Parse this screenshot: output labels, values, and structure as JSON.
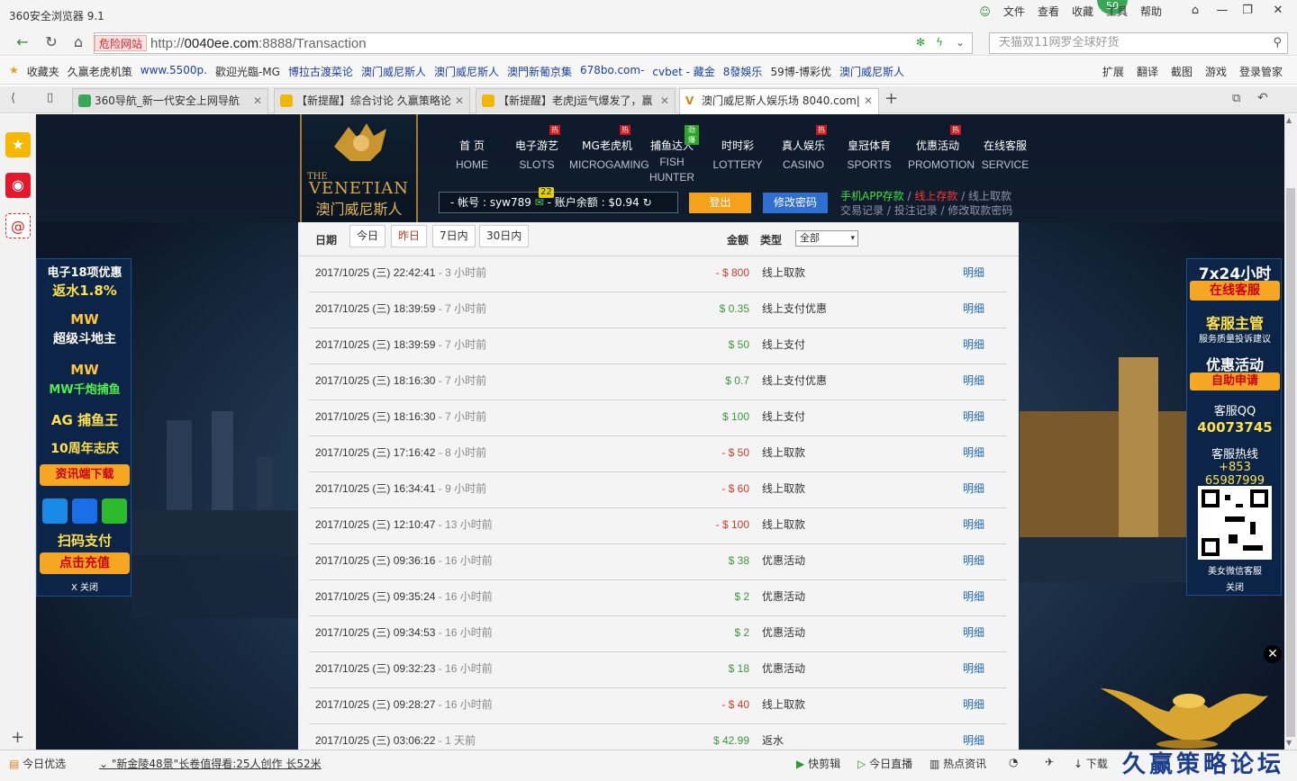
{
  "browser": {
    "title": "360安全浏览器 9.1",
    "menus": [
      "文件",
      "查看",
      "收藏",
      "工具",
      "帮助"
    ],
    "badge": "50",
    "danger_label": "危险网站",
    "url_prefix": "http://",
    "url_host": "0040ee.com",
    "url_rest": ":8888/Transaction",
    "search_placeholder": "天猫双11网罗全球好货"
  },
  "favorites": {
    "label": "收藏夹",
    "items": [
      "久赢老虎机策",
      "www.5500p.",
      "歡迎光臨-MG",
      "博拉古渡菜论",
      "澳门威尼斯人",
      "澳门威尼斯人",
      "澳門新葡京集",
      "678bo.com-",
      "cvbet - 藏金",
      "8發娛乐",
      "59博-博彩优",
      "澳门威尼斯人"
    ],
    "tools": [
      "扩展",
      "翻译",
      "截图",
      "游戏",
      "登录管家"
    ]
  },
  "tabs": [
    {
      "label": "360导航_新一代安全上网导航",
      "active": false
    },
    {
      "label": "【新提醒】综合讨论 久赢策略论",
      "active": false
    },
    {
      "label": "【新提醒】老虎J运气爆发了，赢",
      "active": false
    },
    {
      "label": "澳门威尼斯人娱乐场 8040.com|",
      "active": true
    }
  ],
  "site": {
    "logo_the": "THE",
    "logo_name": "VENETIAN",
    "logo_zh": "澳门威尼斯人",
    "nav": [
      {
        "zh": "首 页",
        "en": "HOME",
        "hot": ""
      },
      {
        "zh": "电子游艺",
        "en": "SLOTS",
        "hot": "热"
      },
      {
        "zh": "MG老虎机",
        "en": "MICROGAMING",
        "hot": "热"
      },
      {
        "zh": "捕鱼达人",
        "en": "FISH HUNTER",
        "hot": "劲爆"
      },
      {
        "zh": "时时彩",
        "en": "LOTTERY",
        "hot": ""
      },
      {
        "zh": "真人娱乐",
        "en": "CASINO",
        "hot": "热"
      },
      {
        "zh": "皇冠体育",
        "en": "SPORTS",
        "hot": ""
      },
      {
        "zh": "优惠活动",
        "en": "PROMOTION",
        "hot": "热"
      },
      {
        "zh": "在线客服",
        "en": "SERVICE",
        "hot": ""
      }
    ],
    "account_text": "- 帐号 : syw789",
    "msg_count": "22",
    "balance_text": "- 账户余额 : $0.94",
    "logout": "登出",
    "change_password": "修改密码",
    "links_row1": [
      "手机APP存款",
      "线上存款",
      "线上取款"
    ],
    "links_row2": [
      "交易记录",
      "投注记录",
      "修改取款密码"
    ]
  },
  "left_panel": [
    "电子18项优惠",
    "返水1.8%",
    "MW",
    "超级斗地主",
    "MW",
    "MW千炮捕鱼",
    "AG 捕鱼王",
    "10周年志庆",
    "资讯端下载",
    "扫码支付",
    "点击充值",
    "X 关闭"
  ],
  "right_panel": [
    "7x24小时",
    "在线客服",
    "客服主管",
    "服务质量投诉建议",
    "优惠活动",
    "自助申请",
    "客服QQ",
    "40073745",
    "客服热线",
    "+853 65987999",
    "美女微信客服",
    "关闭"
  ],
  "filter": {
    "date_label": "日期",
    "buttons": [
      "今日",
      "昨日",
      "7日内",
      "30日内"
    ],
    "amount_label": "金额",
    "type_label": "类型",
    "type_value": "全部"
  },
  "transactions": [
    {
      "date": "2017/10/25 (三) 22:42:41",
      "ago": " - 3 小时前",
      "amount": "- $ 800",
      "type": "线上取款",
      "detail": "明细"
    },
    {
      "date": "2017/10/25 (三) 18:39:59",
      "ago": " - 7 小时前",
      "amount": "$ 0.35",
      "type": "线上支付优惠",
      "detail": "明细"
    },
    {
      "date": "2017/10/25 (三) 18:39:59",
      "ago": " - 7 小时前",
      "amount": "$ 50",
      "type": "线上支付",
      "detail": "明细"
    },
    {
      "date": "2017/10/25 (三) 18:16:30",
      "ago": " - 7 小时前",
      "amount": "$ 0.7",
      "type": "线上支付优惠",
      "detail": "明细"
    },
    {
      "date": "2017/10/25 (三) 18:16:30",
      "ago": " - 7 小时前",
      "amount": "$ 100",
      "type": "线上支付",
      "detail": "明细"
    },
    {
      "date": "2017/10/25 (三) 17:16:42",
      "ago": " - 8 小时前",
      "amount": "- $ 50",
      "type": "线上取款",
      "detail": "明细"
    },
    {
      "date": "2017/10/25 (三) 16:34:41",
      "ago": " - 9 小时前",
      "amount": "- $ 60",
      "type": "线上取款",
      "detail": "明细"
    },
    {
      "date": "2017/10/25 (三) 12:10:47",
      "ago": " - 13 小时前",
      "amount": "- $ 100",
      "type": "线上取款",
      "detail": "明细"
    },
    {
      "date": "2017/10/25 (三) 09:36:16",
      "ago": " - 16 小时前",
      "amount": "$ 38",
      "type": "优惠活动",
      "detail": "明细"
    },
    {
      "date": "2017/10/25 (三) 09:35:24",
      "ago": " - 16 小时前",
      "amount": "$ 2",
      "type": "优惠活动",
      "detail": "明细"
    },
    {
      "date": "2017/10/25 (三) 09:34:53",
      "ago": " - 16 小时前",
      "amount": "$ 2",
      "type": "优惠活动",
      "detail": "明细"
    },
    {
      "date": "2017/10/25 (三) 09:32:23",
      "ago": " - 16 小时前",
      "amount": "$ 18",
      "type": "优惠活动",
      "detail": "明细"
    },
    {
      "date": "2017/10/25 (三) 09:28:27",
      "ago": " - 16 小时前",
      "amount": "- $ 40",
      "type": "线上取款",
      "detail": "明细"
    },
    {
      "date": "2017/10/25 (三) 03:06:22",
      "ago": " - 1 天前",
      "amount": "$ 42.99",
      "type": "返水",
      "detail": "明细"
    }
  ],
  "statusbar": {
    "left": "今日优选",
    "news": "\"新金陵48景\"长卷值得看:25人创作 长52米",
    "items": [
      "快剪辑",
      "今日直播",
      "热点资讯",
      "下载"
    ]
  },
  "watermark": "久赢策略论坛"
}
